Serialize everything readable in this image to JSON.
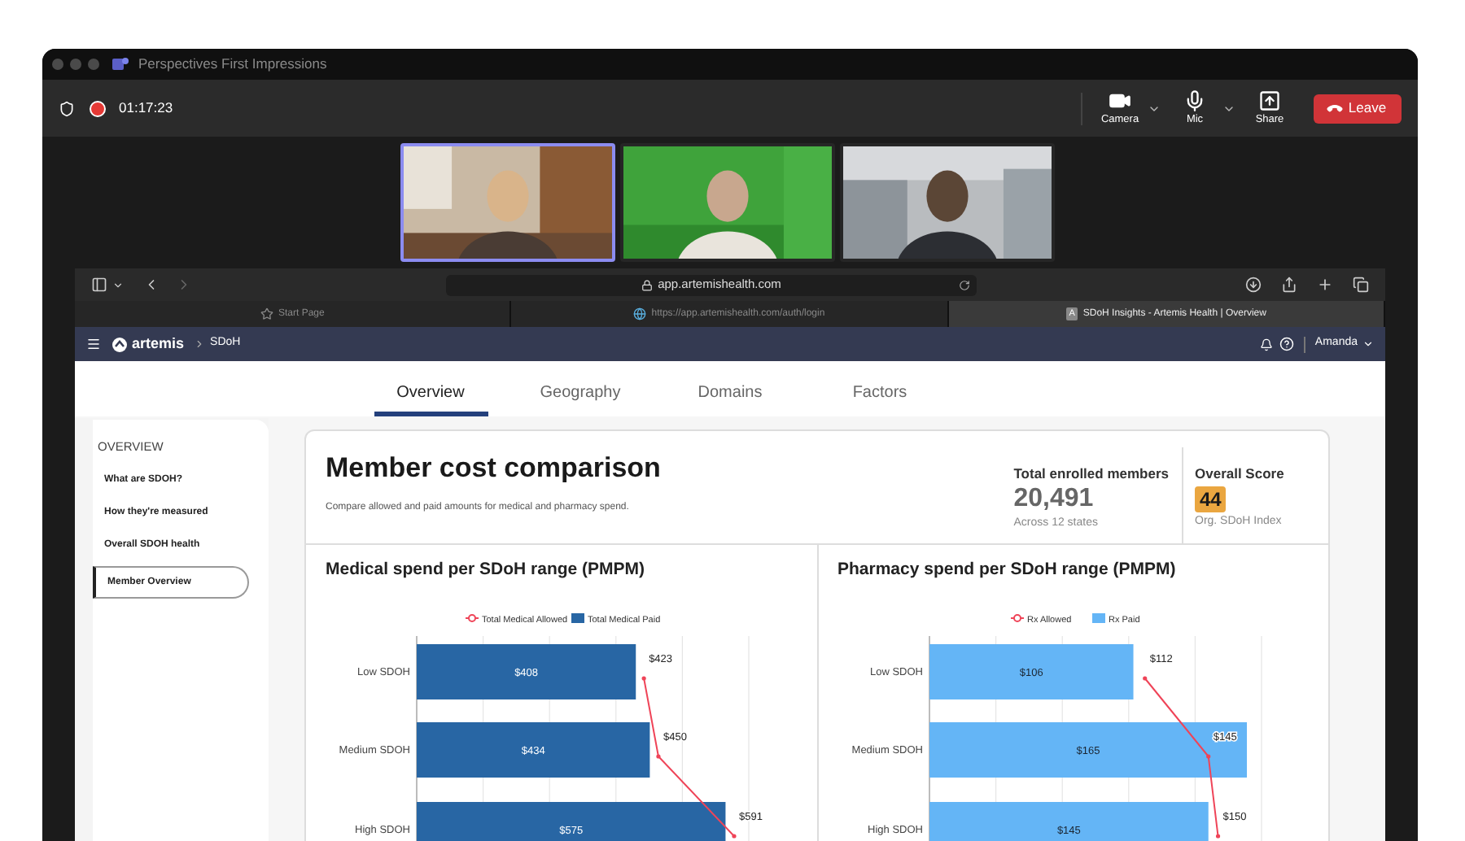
{
  "window": {
    "title": "Perspectives First Impressions"
  },
  "meeting": {
    "timer": "01:17:23",
    "recording": true,
    "controls": [
      {
        "label": "Camera",
        "kind": "camera",
        "has_menu": true
      },
      {
        "label": "Mic",
        "kind": "mic",
        "has_menu": true
      },
      {
        "label": "Share",
        "kind": "share",
        "has_menu": false
      }
    ],
    "leave": "Leave"
  },
  "videos": [
    {
      "kind": "picture",
      "selected": true
    },
    {
      "kind": "picture",
      "selected": false
    },
    {
      "kind": "picture",
      "selected": false
    }
  ],
  "browser": {
    "address": "app.artemishealth.com",
    "tabs": [
      {
        "label": "Start Page",
        "selected": false
      },
      {
        "label": "https://app.artemishealth.com/auth/login",
        "selected": false
      },
      {
        "label": "SDoH Insights - Artemis Health | Overview",
        "badge": "A",
        "selected": true
      }
    ]
  },
  "app": {
    "brand": "artemis",
    "breadcrumb": "SDoH",
    "user": "Amanda"
  },
  "page_tabs": [
    {
      "label": "Overview",
      "selected": true
    },
    {
      "label": "Geography",
      "selected": false
    },
    {
      "label": "Domains",
      "selected": false
    },
    {
      "label": "Factors",
      "selected": false
    }
  ],
  "sidebar": {
    "heading": "OVERVIEW",
    "items": [
      {
        "label": "What are SDOH?",
        "selected": false
      },
      {
        "label": "How they're measured",
        "selected": false
      },
      {
        "label": "Overall SDOH health",
        "selected": false
      },
      {
        "label": "Member Overview",
        "selected": true
      }
    ]
  },
  "card": {
    "title": "Member cost comparison",
    "subtitle": "Compare allowed and paid amounts for medical and pharmacy spend.",
    "stats": [
      {
        "kind": "number",
        "label": "Total enrolled members",
        "value": "20,491",
        "note": "Across 12 states"
      },
      {
        "kind": "badge",
        "label": "Overall Score",
        "value": "44",
        "note": "Org. SDoH Index"
      }
    ]
  },
  "charts": [
    {
      "title": "Medical spend per SDoH range (PMPM)",
      "chart_data": {
        "type": "bar",
        "orientation": "horizontal",
        "categories": [
          "Low SDOH",
          "Medium SDOH",
          "High SDOH"
        ],
        "stacked": false,
        "legend": "top",
        "data_labels": true,
        "series": [
          {
            "name": "Total Medical Allowed",
            "type": "line",
            "color": "#ef4458",
            "values": [
              423,
              450,
              591
            ],
            "value_labels": [
              "$423",
              "$450",
              "$591"
            ]
          },
          {
            "name": "Total Medical Paid",
            "type": "bar",
            "color": "#2866a4",
            "values": [
              408,
              434,
              575
            ],
            "value_labels": [
              "$408",
              "$434",
              "$575"
            ]
          }
        ]
      }
    },
    {
      "title": "Pharmacy spend per SDoH range (PMPM)",
      "chart_data": {
        "type": "bar",
        "orientation": "horizontal",
        "categories": [
          "Low SDOH",
          "Medium SDOH",
          "High SDOH"
        ],
        "stacked": false,
        "legend": "top",
        "data_labels": true,
        "series": [
          {
            "name": "Rx Allowed",
            "type": "line",
            "color": "#ef4458",
            "values": [
              112,
              145,
              150
            ],
            "value_labels": [
              "$112",
              "$145",
              "$150"
            ]
          },
          {
            "name": "Rx Paid",
            "type": "bar",
            "color": "#64b5f6",
            "values": [
              106,
              165,
              145
            ],
            "value_labels": [
              "$106",
              "$165",
              "$145"
            ]
          }
        ]
      }
    }
  ]
}
